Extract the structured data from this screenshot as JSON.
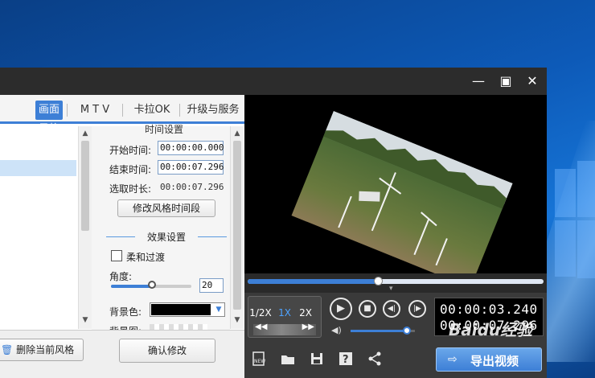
{
  "window": {
    "minimize_glyph": "—",
    "maximize_glyph": "▣",
    "close_glyph": "✕"
  },
  "tabs": [
    {
      "label": "画面风格",
      "active": true
    },
    {
      "label": "M T V",
      "active": false
    },
    {
      "label": "卡拉OK",
      "active": false
    },
    {
      "label": "升级与服务",
      "active": false
    }
  ],
  "time_settings": {
    "header": "时间设置",
    "start_label": "开始时间:",
    "start_value": "00:00:00.000",
    "end_label": "结束时间:",
    "end_value": "00:00:07.296",
    "duration_label": "选取时长:",
    "duration_value": "00:00:07.296",
    "modify_button": "修改风格时间段"
  },
  "effect_settings": {
    "header": "效果设置",
    "soft_transition_label": "柔和过渡",
    "soft_transition_checked": false,
    "angle_label": "角度:",
    "angle_value": "20",
    "angle_fraction": 0.52,
    "bg_color_label": "背景色:",
    "bg_color_value": "#000000",
    "bg_image_label": "背景图:"
  },
  "buttons": {
    "delete_style": "删除当前风格",
    "confirm_modify": "确认修改",
    "export_video": "导出视频"
  },
  "player": {
    "speeds": [
      {
        "label": "1/2X",
        "active": false
      },
      {
        "label": "1X",
        "active": true
      },
      {
        "label": "2X",
        "active": false
      }
    ],
    "current_time": "00:00:03.240",
    "total_time": "00:00:07.296",
    "progress_fraction": 0.44,
    "volume_fraction": 0.88
  },
  "watermark": "Baidu经验",
  "colors": {
    "accent": "#3d7fd6",
    "titlebar": "#2c2c2c",
    "player_bg": "#3a3a3a"
  },
  "icons": [
    "minimize-icon",
    "maximize-icon",
    "close-icon",
    "play-icon",
    "stop-icon",
    "prev-frame-icon",
    "next-frame-icon",
    "rewind-icon",
    "fast-forward-icon",
    "volume-icon",
    "new-project-icon",
    "open-folder-icon",
    "save-icon",
    "help-icon",
    "share-icon",
    "export-icon",
    "delete-icon"
  ]
}
